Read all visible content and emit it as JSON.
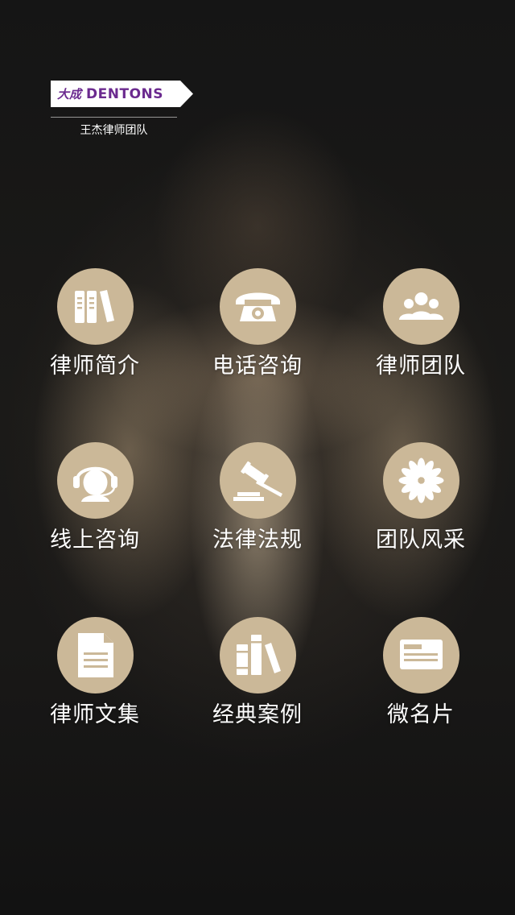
{
  "brand": {
    "logo_cn": "大成",
    "logo_en": "DENTONS",
    "subtitle": "王杰律师团队",
    "logo_text_color": "#6b2a8f"
  },
  "colors": {
    "icon_circle": "#cbb898",
    "label": "#ffffff"
  },
  "menu": [
    {
      "label": "律师简介",
      "icon": "binders-icon"
    },
    {
      "label": "电话咨询",
      "icon": "telephone-icon"
    },
    {
      "label": "律师团队",
      "icon": "team-people-icon"
    },
    {
      "label": "线上咨询",
      "icon": "headset-agent-icon"
    },
    {
      "label": "法律法规",
      "icon": "gavel-icon"
    },
    {
      "label": "团队风采",
      "icon": "flower-icon"
    },
    {
      "label": "律师文集",
      "icon": "document-icon"
    },
    {
      "label": "经典案例",
      "icon": "books-icon"
    },
    {
      "label": "微名片",
      "icon": "business-card-icon"
    }
  ]
}
